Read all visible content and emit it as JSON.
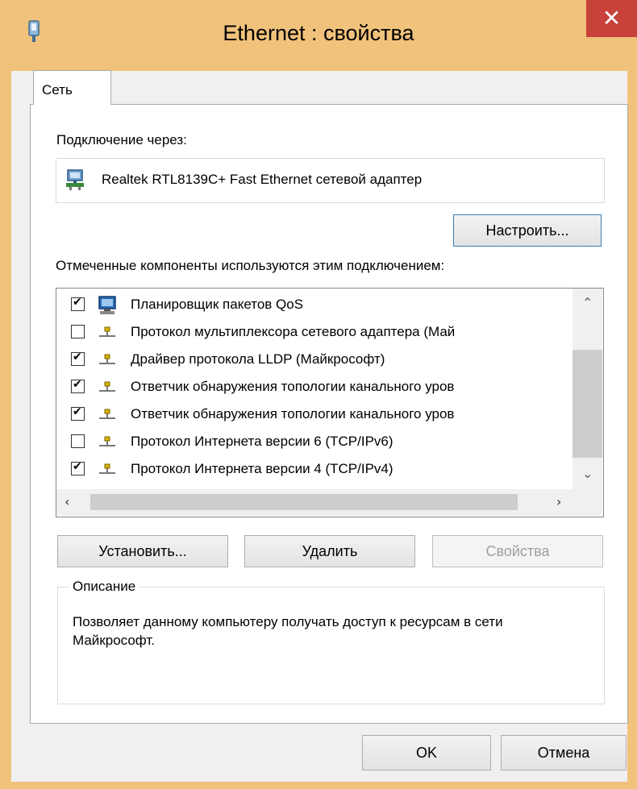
{
  "window": {
    "title": "Ethernet   : свойства",
    "close_glyph": "✕"
  },
  "tab": {
    "label": "Сеть"
  },
  "connect_via": {
    "label": "Подключение через:",
    "adapter_name": "Realtek RTL8139C+ Fast Ethernet сетевой адаптер",
    "adapter_icon": "network-adapter-icon"
  },
  "configure_button": "Настроить...",
  "components": {
    "label": "Отмеченные компоненты используются этим подключением:",
    "items": [
      {
        "label": "Планировщик пакетов QoS",
        "checked": true,
        "icon": "qos-scheduler-icon"
      },
      {
        "label": "Протокол мультиплексора сетевого адаптера (Май",
        "checked": false,
        "icon": "protocol-icon"
      },
      {
        "label": "Драйвер протокола LLDP (Майкрософт)",
        "checked": true,
        "icon": "protocol-icon"
      },
      {
        "label": "Ответчик обнаружения топологии канального уров",
        "checked": true,
        "icon": "protocol-icon"
      },
      {
        "label": "Ответчик обнаружения топологии канального уров",
        "checked": true,
        "icon": "protocol-icon"
      },
      {
        "label": "Протокол Интернета версии 6 (TCP/IPv6)",
        "checked": false,
        "icon": "protocol-icon"
      },
      {
        "label": "Протокол Интернета версии 4 (TCP/IPv4)",
        "checked": true,
        "icon": "protocol-icon"
      }
    ]
  },
  "buttons": {
    "install": "Установить...",
    "remove": "Удалить",
    "properties": "Свойства"
  },
  "description": {
    "title": "Описание",
    "text": "Позволяет данному компьютеру получать доступ к ресурсам в сети Майкрософт."
  },
  "footer": {
    "ok": "OK",
    "cancel": "Отмена"
  },
  "colors": {
    "frame": "#f0c27b",
    "close": "#c7423a",
    "focus_border": "#3c7fb1"
  }
}
